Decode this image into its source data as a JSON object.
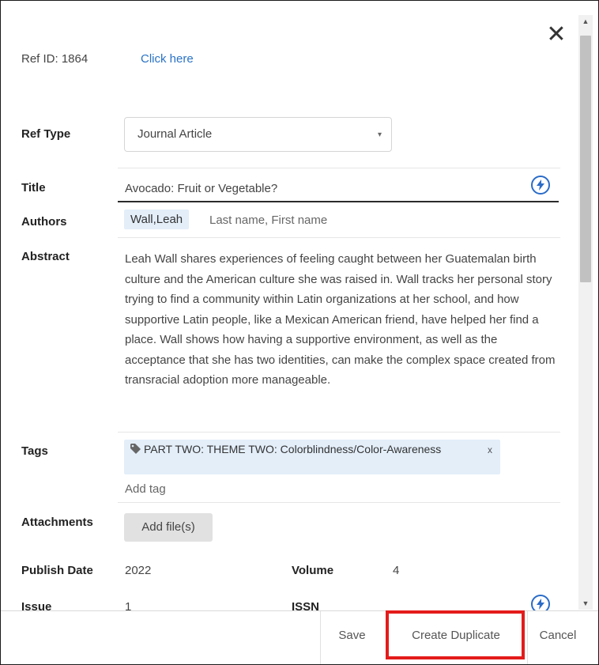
{
  "dialog": {
    "ref_id": "Ref ID: 1864",
    "ref_link": "Click here",
    "close_glyph": "✕"
  },
  "fields": {
    "ref_type_label": "Ref Type",
    "ref_type_value": "Journal Article",
    "title_label": "Title",
    "title_value": "Avocado: Fruit or Vegetable?",
    "authors_label": "Authors",
    "author_chip": "Wall,Leah",
    "author_placeholder": "Last name, First name",
    "abstract_label": "Abstract",
    "abstract_value": "Leah Wall shares experiences of feeling caught between her Guatemalan birth culture and the American culture she was raised in. Wall tracks her personal story trying to find a community within Latin organizations at her school, and how supportive Latin people, like a Mexican American friend, have helped her find a place. Wall shows how having a supportive environment, as well as the acceptance that she has two identities, can make the complex space created from transracial adoption more manageable.",
    "tags_label": "Tags",
    "tag_chip": "PART TWO: THEME TWO: Colorblindness/Color-Awareness",
    "tag_remove": "x",
    "add_tag_placeholder": "Add tag",
    "attachments_label": "Attachments",
    "add_files_button": "Add file(s)",
    "publish_date_label": "Publish Date",
    "publish_date_value": "2022",
    "volume_label": "Volume",
    "volume_value": "4",
    "issue_label": "Issue",
    "issue_value": "1",
    "issn_label": "ISSN"
  },
  "footer": {
    "save_label": "Save",
    "create_duplicate_label": "Create Duplicate",
    "cancel_label": "Cancel"
  },
  "icons": {
    "bolt": "⚡",
    "tag": "tag-icon",
    "caret": "▾"
  },
  "colors": {
    "link": "#2a73c7",
    "chip_bg": "#e3eef9",
    "highlight": "#e41b1b"
  }
}
